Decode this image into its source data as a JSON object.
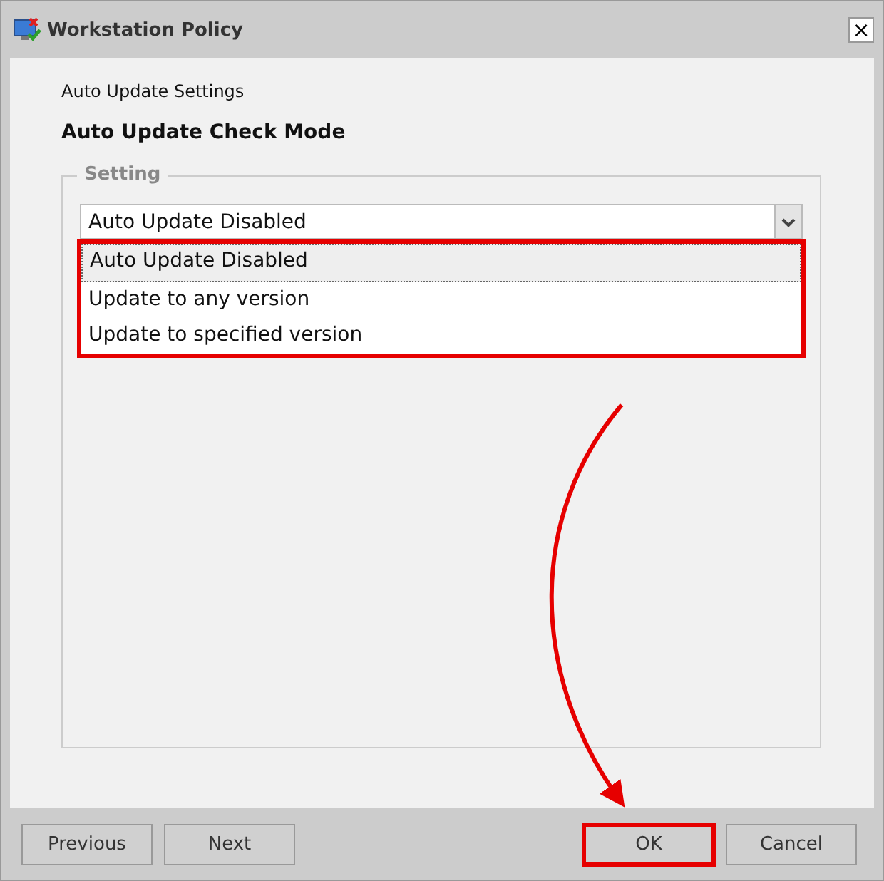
{
  "window": {
    "title": "Workstation Policy",
    "close": "×"
  },
  "breadcrumb": "Auto Update Settings",
  "heading": "Auto Update Check Mode",
  "setting": {
    "legend": "Setting",
    "value": "Auto Update Disabled",
    "expanded": true,
    "highlighted": true,
    "options": [
      {
        "label": "Auto Update Disabled",
        "selected": true
      },
      {
        "label": "Update to any version",
        "selected": false
      },
      {
        "label": "Update to specified version",
        "selected": false
      }
    ]
  },
  "buttons": [
    {
      "label": "Previous",
      "kind": "left",
      "highlighted": false
    },
    {
      "label": "Next",
      "kind": "left",
      "highlighted": false
    },
    {
      "label": "OK",
      "kind": "right",
      "highlighted": true
    },
    {
      "label": "Cancel",
      "kind": "right",
      "highlighted": false
    }
  ],
  "annotation": {
    "kind": "arrow"
  }
}
